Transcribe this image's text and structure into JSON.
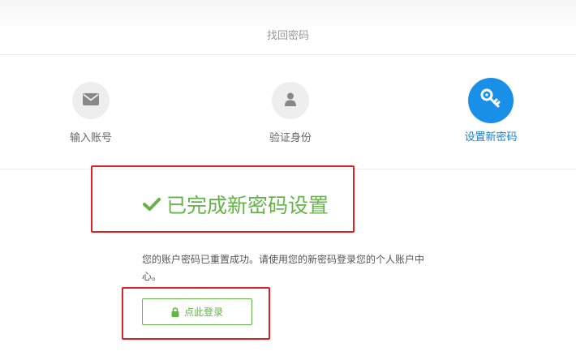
{
  "header": {
    "title": "找回密码"
  },
  "steps": [
    {
      "label": "输入账号",
      "icon": "envelope-icon"
    },
    {
      "label": "验证身份",
      "icon": "user-icon"
    },
    {
      "label": "设置新密码",
      "icon": "key-icon",
      "active": true
    }
  ],
  "result": {
    "title": "已完成新密码设置",
    "description": "您的账户密码已重置成功。请使用您的新密码登录您的个人账户中心。",
    "button_label": "点此登录"
  },
  "colors": {
    "accent_blue": "#1a8fe8",
    "success_green": "#66b34a",
    "highlight_red": "#e02020"
  }
}
